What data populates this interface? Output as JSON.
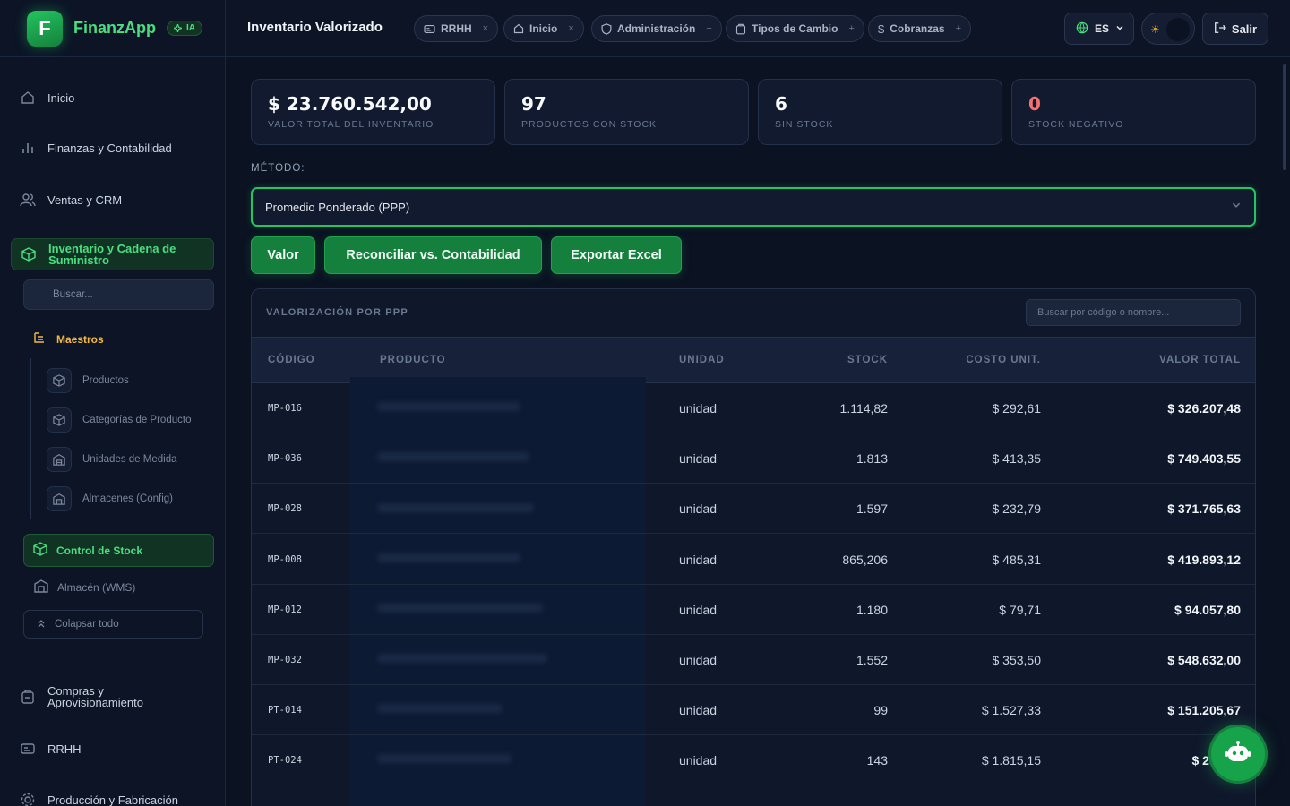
{
  "brand": {
    "initial": "F",
    "name": "FinanzApp",
    "ia_badge": "IA"
  },
  "sidebar": {
    "items": [
      {
        "label": "Inicio",
        "icon": "home-icon"
      },
      {
        "label": "Finanzas y Contabilidad",
        "icon": "bar-chart-icon"
      },
      {
        "label": "Ventas y CRM",
        "icon": "users-icon"
      },
      {
        "label": "Inventario y Cadena de Suministro",
        "icon": "box-icon",
        "active": true
      },
      {
        "label": "Compras y Aprovisionamiento",
        "icon": "clipboard-icon"
      },
      {
        "label": "RRHH",
        "icon": "id-card-icon"
      },
      {
        "label": "Producción y Fabricación",
        "icon": "gear-icon"
      }
    ],
    "search_placeholder": "Buscar...",
    "group_label": "Maestros",
    "sub_items": [
      "Productos",
      "Categorías de Producto",
      "Unidades de Medida",
      "Almacenes (Config)"
    ],
    "control_stock": "Control de Stock",
    "wms": "Almacén (WMS)",
    "collapse": "Colapsar todo"
  },
  "header": {
    "title": "Inventario Valorizado",
    "tabs": [
      {
        "label": "RRHH",
        "icon": "id-card-icon",
        "close": "×"
      },
      {
        "label": "Inicio",
        "icon": "home-icon",
        "close": "×"
      },
      {
        "label": "Administración",
        "icon": "shield-icon",
        "close": "+"
      },
      {
        "label": "Tipos de Cambio",
        "icon": "clipboard-icon",
        "close": "+"
      },
      {
        "label": "Cobranzas",
        "icon": "dollar-icon",
        "close": "+"
      }
    ],
    "language": "ES",
    "logout": "Salir"
  },
  "stats": [
    {
      "value": "$ 23.760.542,00",
      "label": "VALOR TOTAL DEL INVENTARIO"
    },
    {
      "value": "97",
      "label": "PRODUCTOS CON STOCK"
    },
    {
      "value": "6",
      "label": "SIN STOCK"
    },
    {
      "value": "0",
      "label": "STOCK NEGATIVO",
      "color": "#f87171"
    }
  ],
  "method": {
    "label": "MÉTODO:",
    "selected": "Promedio Ponderado (PPP)"
  },
  "actions": [
    "Valor",
    "Reconciliar vs. Contabilidad",
    "Exportar Excel"
  ],
  "table": {
    "title": "VALORIZACIÓN POR PPP",
    "search_placeholder": "Buscar por código o nombre...",
    "columns": [
      "CÓDIGO",
      "PRODUCTO",
      "UNIDAD",
      "STOCK",
      "COSTO UNIT.",
      "VALOR TOTAL"
    ],
    "rows": [
      {
        "code": "MP-016",
        "unit": "unidad",
        "stock": "1.114,82",
        "cost": "$ 292,61",
        "total": "$ 326.207,48"
      },
      {
        "code": "MP-036",
        "unit": "unidad",
        "stock": "1.813",
        "cost": "$ 413,35",
        "total": "$ 749.403,55"
      },
      {
        "code": "MP-028",
        "unit": "unidad",
        "stock": "1.597",
        "cost": "$ 232,79",
        "total": "$ 371.765,63"
      },
      {
        "code": "MP-008",
        "unit": "unidad",
        "stock": "865,206",
        "cost": "$ 485,31",
        "total": "$ 419.893,12"
      },
      {
        "code": "MP-012",
        "unit": "unidad",
        "stock": "1.180",
        "cost": "$ 79,71",
        "total": "$ 94.057,80"
      },
      {
        "code": "MP-032",
        "unit": "unidad",
        "stock": "1.552",
        "cost": "$ 353,50",
        "total": "$ 548.632,00"
      },
      {
        "code": "PT-014",
        "unit": "unidad",
        "stock": "99",
        "cost": "$ 1.527,33",
        "total": "$ 151.205,67"
      },
      {
        "code": "PT-024",
        "unit": "unidad",
        "stock": "143",
        "cost": "$ 1.815,15",
        "total": "$ 259.56"
      }
    ]
  },
  "colors": {
    "accent": "#22c55e",
    "accent_dark": "#15803d",
    "negative": "#f87171",
    "warning": "#f5b942"
  }
}
